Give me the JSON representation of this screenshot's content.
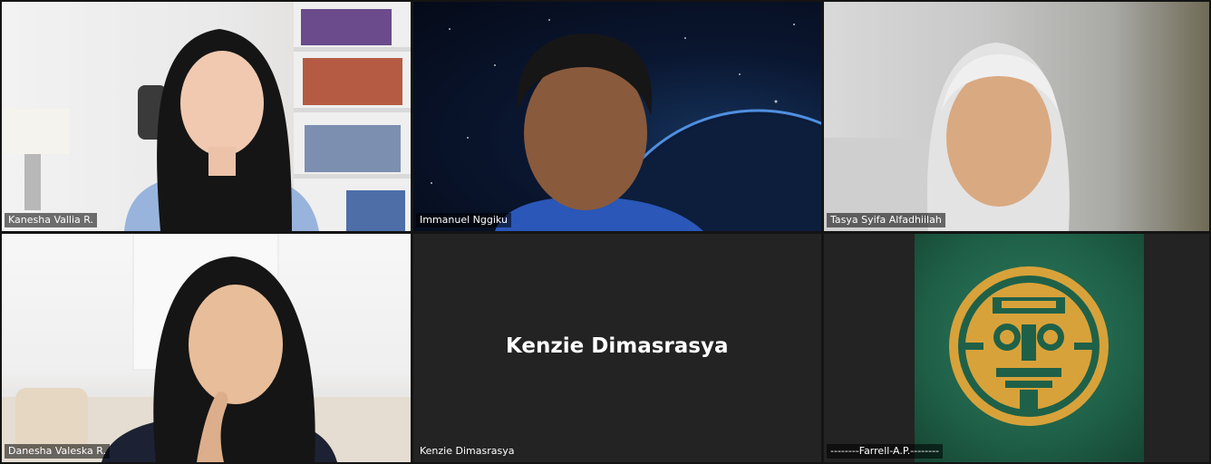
{
  "meeting": {
    "tiles": [
      {
        "id": "kanesha",
        "name": "Kanesha Vallia R."
      },
      {
        "id": "immanuel",
        "name": "Immanuel Nggiku"
      },
      {
        "id": "tasya",
        "name": "Tasya Syifa Alfadhiilah"
      },
      {
        "id": "danesha",
        "name": "Danesha Valeska R."
      },
      {
        "id": "kenzie",
        "name": "Kenzie Dimasrasya",
        "display_name": "Kenzie Dimasrasya"
      },
      {
        "id": "farrell",
        "name": "--------Farrell-A.P.--------"
      }
    ]
  },
  "colors": {
    "background": "#141414",
    "tile_off": "#232323",
    "logo_gold": "#d8a23a",
    "logo_green": "#1f6148"
  },
  "icons": {
    "farrell_avatar": "aztec-mask-icon"
  }
}
